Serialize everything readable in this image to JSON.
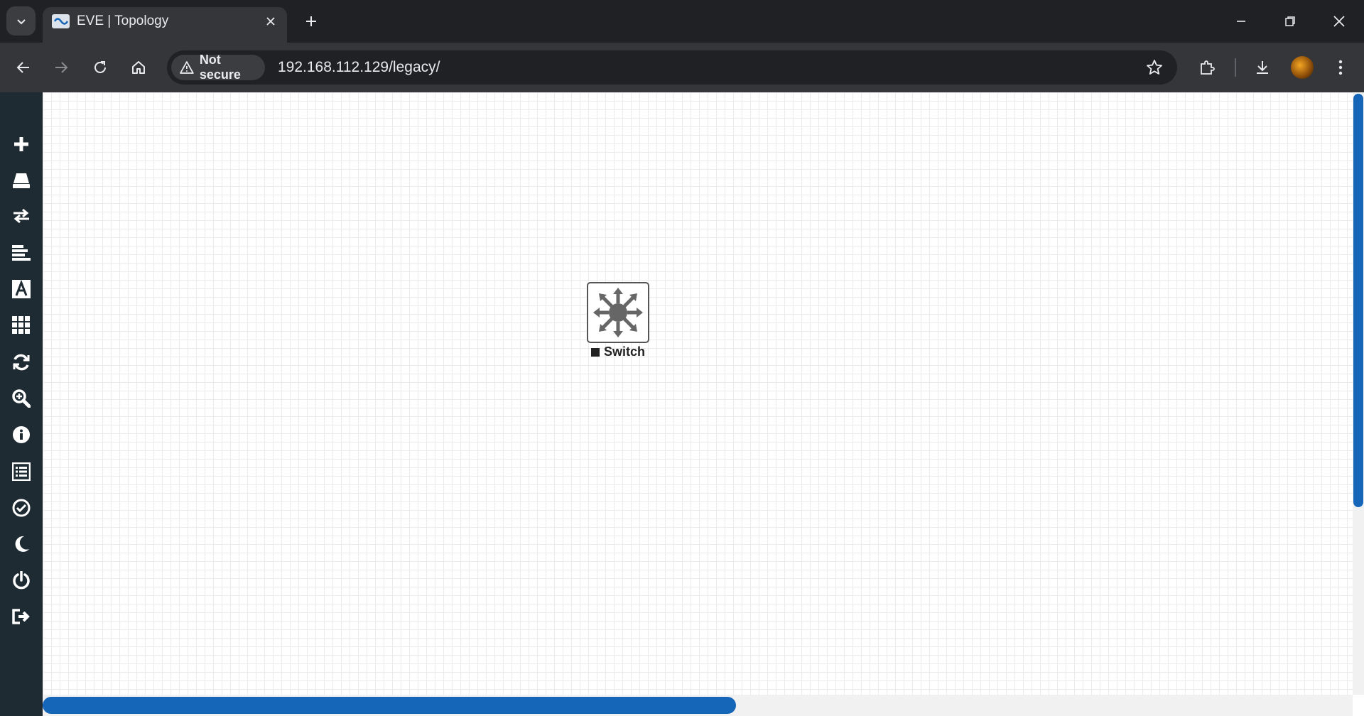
{
  "browser": {
    "tab": {
      "title": "EVE | Topology",
      "favicon": "eve-favicon"
    },
    "address_bar": {
      "security_label": "Not secure",
      "url": "192.168.112.129/legacy/"
    }
  },
  "sidebar": {
    "items": [
      {
        "icon": "plus-icon",
        "label": "Add an object"
      },
      {
        "icon": "nodes-icon",
        "label": "Nodes"
      },
      {
        "icon": "networks-icon",
        "label": "Networks"
      },
      {
        "icon": "startup-configs-icon",
        "label": "Startup-configs"
      },
      {
        "icon": "text-icon",
        "label": "Text"
      },
      {
        "icon": "grid-icon",
        "label": "Lab details"
      },
      {
        "icon": "refresh-icon",
        "label": "Refresh topology"
      },
      {
        "icon": "zoom-icon",
        "label": "Zoom"
      },
      {
        "icon": "info-icon",
        "label": "Status"
      },
      {
        "icon": "list-icon",
        "label": "Lab details"
      },
      {
        "icon": "check-icon",
        "label": "Lock lab"
      },
      {
        "icon": "moon-icon",
        "label": "Dark mode"
      },
      {
        "icon": "power-icon",
        "label": "Close lab"
      },
      {
        "icon": "logout-icon",
        "label": "Logout"
      }
    ]
  },
  "topology": {
    "nodes": [
      {
        "name": "Switch",
        "status": "stopped",
        "icon": "switch-icon"
      }
    ]
  },
  "colors": {
    "sidebar_bg": "#1f2b33",
    "scroll_thumb": "#1565b8",
    "chrome_dark": "#202124"
  }
}
